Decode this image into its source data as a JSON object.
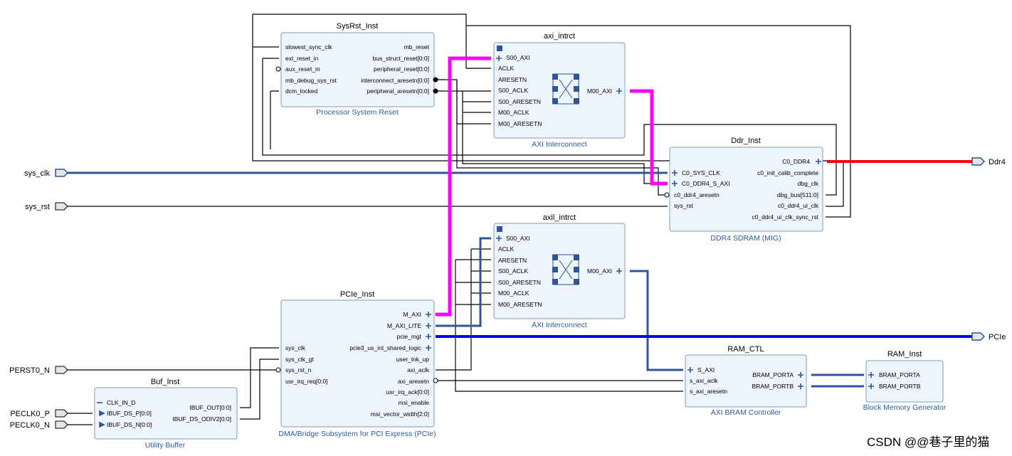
{
  "blocks": {
    "sysrst": {
      "instance": "SysRst_Inst",
      "name": "Processor System Reset",
      "inputs": [
        "slowest_sync_clk",
        "ext_reset_in",
        "aux_reset_in",
        "mb_debug_sys_rst",
        "dcm_locked"
      ],
      "outputs": [
        "mb_reset",
        "bus_struct_reset[0:0]",
        "peripheral_reset[0:0]",
        "interconnect_aresetn[0:0]",
        "peripheral_aresetn[0:0]"
      ]
    },
    "axi1": {
      "instance": "axi_intrct",
      "name": "AXI Interconnect",
      "inputs": [
        "S00_AXI",
        "ACLK",
        "ARESETN",
        "S00_ACLK",
        "S00_ARESETN",
        "M00_ACLK",
        "M00_ARESETN"
      ],
      "outputs": [
        "M00_AXI"
      ]
    },
    "axi2": {
      "instance": "axil_intrct",
      "name": "AXI Interconnect",
      "inputs": [
        "S00_AXI",
        "ACLK",
        "ARESETN",
        "S00_ACLK",
        "S00_ARESETN",
        "M00_ACLK",
        "M00_ARESETN"
      ],
      "outputs": [
        "M00_AXI"
      ]
    },
    "ddr": {
      "instance": "Ddr_Inst",
      "name": "DDR4 SDRAM (MIG)",
      "inputs": [
        "C0_SYS_CLK",
        "C0_DDR4_S_AXI",
        "c0_ddr4_aresetn",
        "sys_rst"
      ],
      "outputs": [
        "C0_DDR4",
        "c0_init_calib_complete",
        "dbg_clk",
        "dbg_bus[511:0]",
        "c0_ddr4_ui_clk",
        "c0_ddr4_ui_clk_sync_rst"
      ]
    },
    "pcie": {
      "instance": "PCIe_Inst",
      "name": "DMA/Bridge Subsystem for PCI Express (PCIe)",
      "inputs": [
        "sys_clk",
        "sys_clk_gt",
        "sys_rst_n",
        "usr_irq_req[0:0]"
      ],
      "outputs": [
        "M_AXI",
        "M_AXI_LITE",
        "pcie_mgt",
        "pcie3_us_int_shared_logic",
        "user_lnk_up",
        "axi_aclk",
        "axi_aresetn",
        "usr_irq_ack[0:0]",
        "msi_enable",
        "msi_vector_width[2:0]"
      ]
    },
    "buf": {
      "instance": "Buf_Inst",
      "name": "Utility Buffer",
      "inputs": [
        "CLK_IN_D",
        "IBUF_DS_P[0:0]",
        "IBUF_DS_N[0:0]"
      ],
      "outputs": [
        "IBUF_OUT[0:0]",
        "IBUF_DS_ODIV2[0:0]"
      ]
    },
    "ramctl": {
      "instance": "RAM_CTL",
      "name": "AXI BRAM Controller",
      "inputs": [
        "S_AXI",
        "s_axi_aclk",
        "s_axi_aresetn"
      ],
      "outputs": [
        "BRAM_PORTA",
        "BRAM_PORTB"
      ]
    },
    "ram": {
      "instance": "RAM_Inst",
      "name": "Block Memory Generator",
      "inputs": [
        "BRAM_PORTA",
        "BRAM_PORTB"
      ],
      "outputs": []
    }
  },
  "ports": {
    "sys_clk": "sys_clk",
    "sys_rst": "sys_rst",
    "perst0_n": "PERST0_N",
    "peclk0_p": "PECLK0_P",
    "peclk0_n": "PECLK0_N",
    "ddr4": "Ddr4",
    "pcie": "PCIe"
  },
  "colors": {
    "block_fill": "#eef4fb",
    "block_border": "#7f9bbd",
    "net": "#000000",
    "bus": "#2f5597",
    "axi_highlight": "#ff00ff",
    "ddr4_highlight": "#ff0000",
    "pcie_highlight": "#0000ff",
    "subtitle": "#2f5b9a"
  },
  "watermark": "CSDN @@巷子里的猫"
}
